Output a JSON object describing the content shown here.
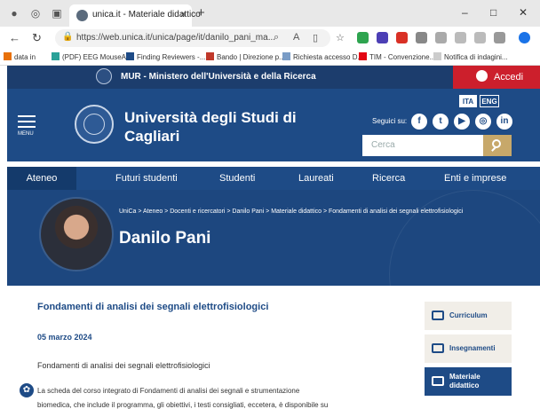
{
  "browser": {
    "tab_title": "unica.it - Materiale didattico",
    "tab_close": "×",
    "new_tab": "+",
    "url": "https://web.unica.it/unica/page/it/danilo_pani_ma...",
    "bookmarks": [
      "data in",
      "(PDF) EEG MouseA...",
      "Finding Reviewers -...",
      "Bando | Direzione p...",
      "Richiesta accesso D...",
      "TIM - Convenzione...",
      "Notifica di indagini..."
    ],
    "minimize": "–",
    "maximize": "□",
    "close": "✕"
  },
  "topbar": {
    "mur": "MUR - Ministero dell'Università e della Ricerca",
    "login": "Accedi"
  },
  "header": {
    "menu": "MENU",
    "title_line1": "Università degli Studi di",
    "title_line2": "Cagliari",
    "lang_it": "ITA",
    "lang_en": "ENG",
    "follow": "Seguici su:",
    "search_placeholder": "Cerca"
  },
  "nav": [
    "Ateneo",
    "Futuri studenti",
    "Studenti",
    "Laureati",
    "Ricerca",
    "Enti e imprese"
  ],
  "hero": {
    "breadcrumb": "UniCa > Ateneo > Docenti e ricercatori > Danilo Pani > Materiale didattico > Fondamenti di analisi dei segnali elettrofisiologici",
    "name": "Danilo Pani"
  },
  "content": {
    "title": "Fondamenti di analisi dei segnali elettrofisiologici",
    "date": "05 marzo 2024",
    "subtitle": "Fondamenti di analisi dei segnali elettrofisiologici",
    "para1": "La scheda del corso integrato di Fondamenti di analisi dei segnali e strumentazione",
    "para2": "biomedica, che include il programma, gli obiettivi, i testi consigliati, eccetera, è disponibile su"
  },
  "sidebar": [
    "Curriculum",
    "Insegnamenti",
    "Materiale didattico"
  ],
  "colors": {
    "primary": "#1e4b86",
    "accent_red": "#cc1f2c",
    "gold": "#c7a86a"
  }
}
